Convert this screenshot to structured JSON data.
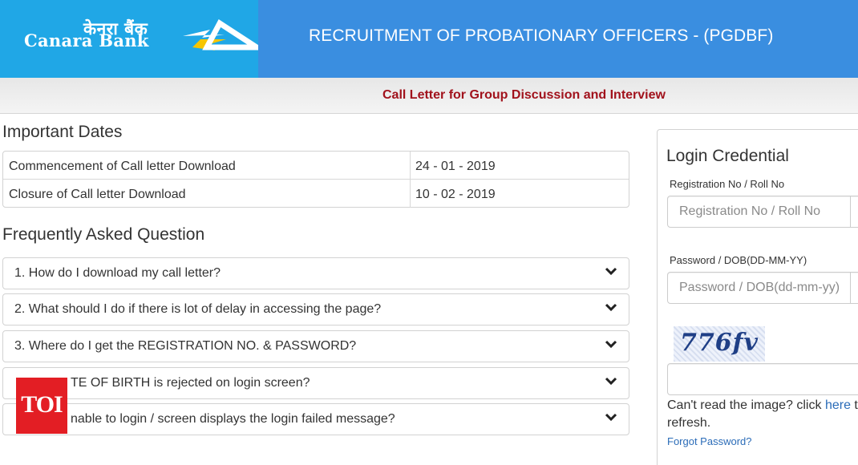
{
  "header": {
    "logo_hindi": "केनरा बैंक",
    "logo_english": "Canara Bank",
    "title": "RECRUITMENT OF PROBATIONARY OFFICERS - (PGDBF)",
    "colors": {
      "brand_blue": "#20a7e6",
      "header_blue": "#3a8ee0",
      "logo_yellow": "#f6c500"
    }
  },
  "subheader": {
    "text": "Call Letter for Group Discussion and Interview",
    "color": "#a1121c"
  },
  "important_dates": {
    "heading": "Important Dates",
    "rows": [
      {
        "label": "Commencement of Call letter Download",
        "value": "24 - 01 - 2019"
      },
      {
        "label": "Closure of Call letter Download",
        "value": "10 - 02 - 2019"
      }
    ]
  },
  "faq": {
    "heading": "Frequently Asked Question",
    "items": [
      {
        "text": "1. How do I download my call letter?"
      },
      {
        "text": "2. What should I do if there is lot of delay in accessing the page?"
      },
      {
        "text": "3. Where do I get the REGISTRATION NO. & PASSWORD?"
      },
      {
        "text": "TE OF BIRTH is rejected on login screen?"
      },
      {
        "text": "nable to login / screen displays the login failed message?"
      }
    ],
    "chevron_icon": "chevron-down-icon"
  },
  "watermark": {
    "text": "TOI",
    "color": "#e31e24"
  },
  "login": {
    "title": "Login Credential",
    "registration_label": "Registration No / Roll No",
    "registration_placeholder": "Registration No / Roll No",
    "password_label": "Password / DOB(DD-MM-YY)",
    "password_placeholder": "Password / DOB(dd-mm-yy)",
    "captcha_text": "776fv",
    "captcha_value": "",
    "help_prefix": "Can't read the image? click ",
    "help_link": "here",
    "help_suffix": " t",
    "help_line2": "refresh.",
    "forgot_password": "Forgot Password?",
    "link_color": "#2b6cb8"
  }
}
